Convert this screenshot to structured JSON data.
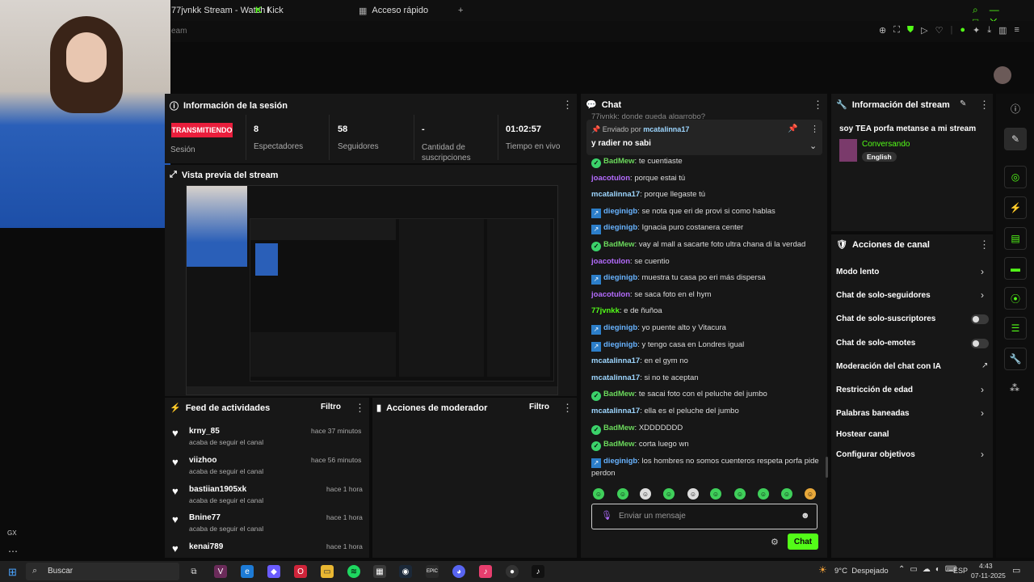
{
  "browser": {
    "tabs": [
      {
        "label": "77jvnkk Stream - Watch l"
      },
      {
        "label": "Kick"
      },
      {
        "label": "Acceso rápido"
      }
    ],
    "new_tab": "+",
    "address_fragment": "eam"
  },
  "session": {
    "title": "Información de la sesión",
    "status_badge": "TRANSMITIENDO",
    "status_label": "Sesión",
    "stats": [
      {
        "value": "8",
        "label": "Espectadores"
      },
      {
        "value": "58",
        "label": "Seguidores"
      },
      {
        "value": "-",
        "label": "Cantidad de suscripciones"
      },
      {
        "value": "01:02:57",
        "label": "Tiempo en vivo"
      }
    ]
  },
  "preview": {
    "title": "Vista previa del stream"
  },
  "feed": {
    "title": "Feed de actividades",
    "filter": "Filtro",
    "items": [
      {
        "user": "krny_85",
        "desc": "acaba de seguir el canal",
        "time": "hace 37 minutos"
      },
      {
        "user": "viizhoo",
        "desc": "acaba de seguir el canal",
        "time": "hace 56 minutos"
      },
      {
        "user": "bastiian1905xk",
        "desc": "acaba de seguir el canal",
        "time": "hace 1 hora"
      },
      {
        "user": "Bnine77",
        "desc": "acaba de seguir el canal",
        "time": "hace 1 hora"
      },
      {
        "user": "kenai789",
        "desc": "",
        "time": "hace 1 hora"
      }
    ]
  },
  "moderator": {
    "title": "Acciones de moderador",
    "filter": "Filtro"
  },
  "chat": {
    "title": "Chat",
    "top_partial": "77jvnkk: donde queda algarrobo?",
    "pinned_by_prefix": "Enviado por",
    "pinned_by_user": "mcatalinna17",
    "pinned_text": "y radier no sabi",
    "messages": [
      {
        "user": "BadMew",
        "text": "te cuentiaste",
        "color": "u-lime",
        "badge": "v"
      },
      {
        "user": "joacotulon",
        "text": "porque estai tú",
        "color": "u-purple",
        "badge": ""
      },
      {
        "user": "mcatalinna17",
        "text": "porque llegaste tú",
        "color": "u-teal",
        "badge": ""
      },
      {
        "user": "dieginigb",
        "text": "se nota que eri de provi si como hablas",
        "color": "u-blue",
        "badge": "b"
      },
      {
        "user": "dieginigb",
        "text": "Ignacia puro costanera center",
        "color": "u-blue",
        "badge": "b"
      },
      {
        "user": "BadMew",
        "text": "vay al mall a sacarte foto ultra chana di la verdad",
        "color": "u-lime",
        "badge": "v"
      },
      {
        "user": "joacotulon",
        "text": "se cuentio",
        "color": "u-purple",
        "badge": ""
      },
      {
        "user": "dieginigb",
        "text": "muestra tu casa po eri más dispersa",
        "color": "u-blue",
        "badge": "b"
      },
      {
        "user": "joacotulon",
        "text": "se saca foto en el hym",
        "color": "u-purple",
        "badge": ""
      },
      {
        "user": "77jvnkk",
        "text": "e de ñuñoa",
        "color": "u-green",
        "badge": ""
      },
      {
        "user": "dieginigb",
        "text": "yo puente alto y Vitacura",
        "color": "u-blue",
        "badge": "b"
      },
      {
        "user": "dieginigb",
        "text": "y tengo casa en Londres igual",
        "color": "u-blue",
        "badge": "b"
      },
      {
        "user": "mcatalinna17",
        "text": "en el gym no",
        "color": "u-teal",
        "badge": ""
      },
      {
        "user": "mcatalinna17",
        "text": "si no te aceptan",
        "color": "u-teal",
        "badge": ""
      },
      {
        "user": "BadMew",
        "text": "te sacai foto con el peluche del jumbo",
        "color": "u-lime",
        "badge": "v"
      },
      {
        "user": "mcatalinna17",
        "text": "ella es el peluche del jumbo",
        "color": "u-teal",
        "badge": ""
      },
      {
        "user": "BadMew",
        "text": "XDDDDDDD",
        "color": "u-lime",
        "badge": "v"
      },
      {
        "user": "BadMew",
        "text": "corta luego wn",
        "color": "u-lime",
        "badge": "v"
      },
      {
        "user": "dieginigb",
        "text": "los hombres no somos cuenteros respeta porfa pide",
        "color": "u-blue",
        "badge": "b"
      }
    ],
    "last_wrap": "perdon",
    "input_placeholder": "Enviar un mensaje",
    "send_label": "Chat"
  },
  "stream_info": {
    "title": "Información del stream",
    "stream_title": "soy TEA porfa metanse a mi stream",
    "category": "Conversando",
    "language": "English"
  },
  "channel_actions": {
    "title": "Acciones de canal",
    "items": [
      {
        "label": "Modo lento",
        "control": "chevron"
      },
      {
        "label": "Chat de solo-seguidores",
        "control": "chevron"
      },
      {
        "label": "Chat de solo-suscriptores",
        "control": "toggle"
      },
      {
        "label": "Chat de solo-emotes",
        "control": "toggle"
      },
      {
        "label": "Moderación del chat con IA",
        "control": "external"
      },
      {
        "label": "Restricción de edad",
        "control": "chevron"
      },
      {
        "label": "Palabras baneadas",
        "control": "chevron"
      },
      {
        "label": "Hostear canal",
        "control": "none"
      },
      {
        "label": "Configurar objetivos",
        "control": "chevron"
      }
    ]
  },
  "taskbar": {
    "search": "Buscar",
    "weather": "9°C  Despejado",
    "lang": "ESP",
    "time": "4:43",
    "date": "07-11-2025"
  },
  "sidebar_badge": "GX",
  "colors": {
    "accent": "#53fc18",
    "live": "#e91e3c",
    "panel": "#171717"
  }
}
